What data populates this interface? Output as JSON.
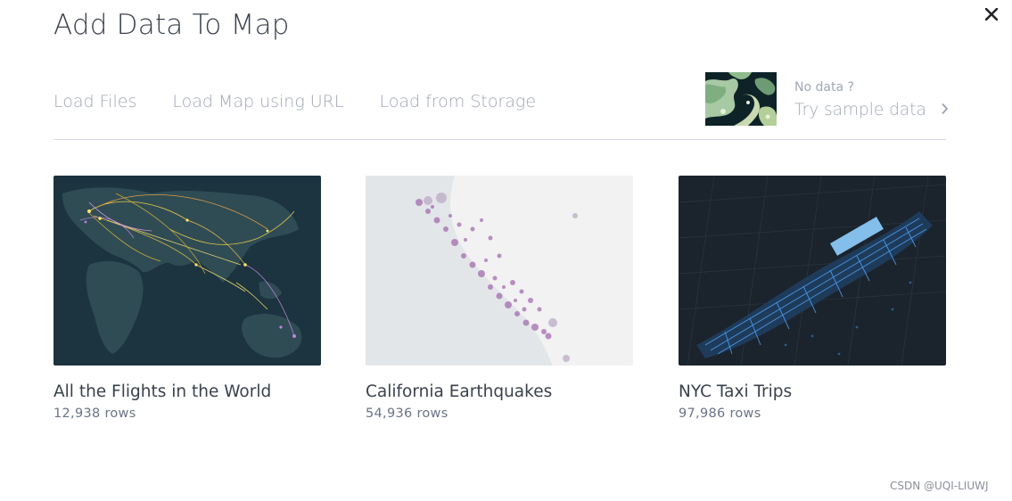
{
  "modal": {
    "title": "Add Data To Map"
  },
  "tabs": [
    {
      "label": "Load Files"
    },
    {
      "label": "Load Map using URL"
    },
    {
      "label": "Load from Storage"
    }
  ],
  "sample": {
    "no_data_label": "No data ?",
    "try_label": "Try sample data",
    "chevron_icon": "chevron-right-icon"
  },
  "datasets": [
    {
      "title": "All the Flights in the World",
      "rows": "12,938 rows"
    },
    {
      "title": "California Earthquakes",
      "rows": "54,936 rows"
    },
    {
      "title": "NYC Taxi Trips",
      "rows": "97,986 rows"
    }
  ],
  "icons": {
    "close": "close-icon"
  },
  "watermark": "CSDN @UQI-LIUWJ",
  "colors": {
    "text": "#3a414c",
    "muted": "#a0a7b4",
    "divider": "#d3d8e0"
  }
}
